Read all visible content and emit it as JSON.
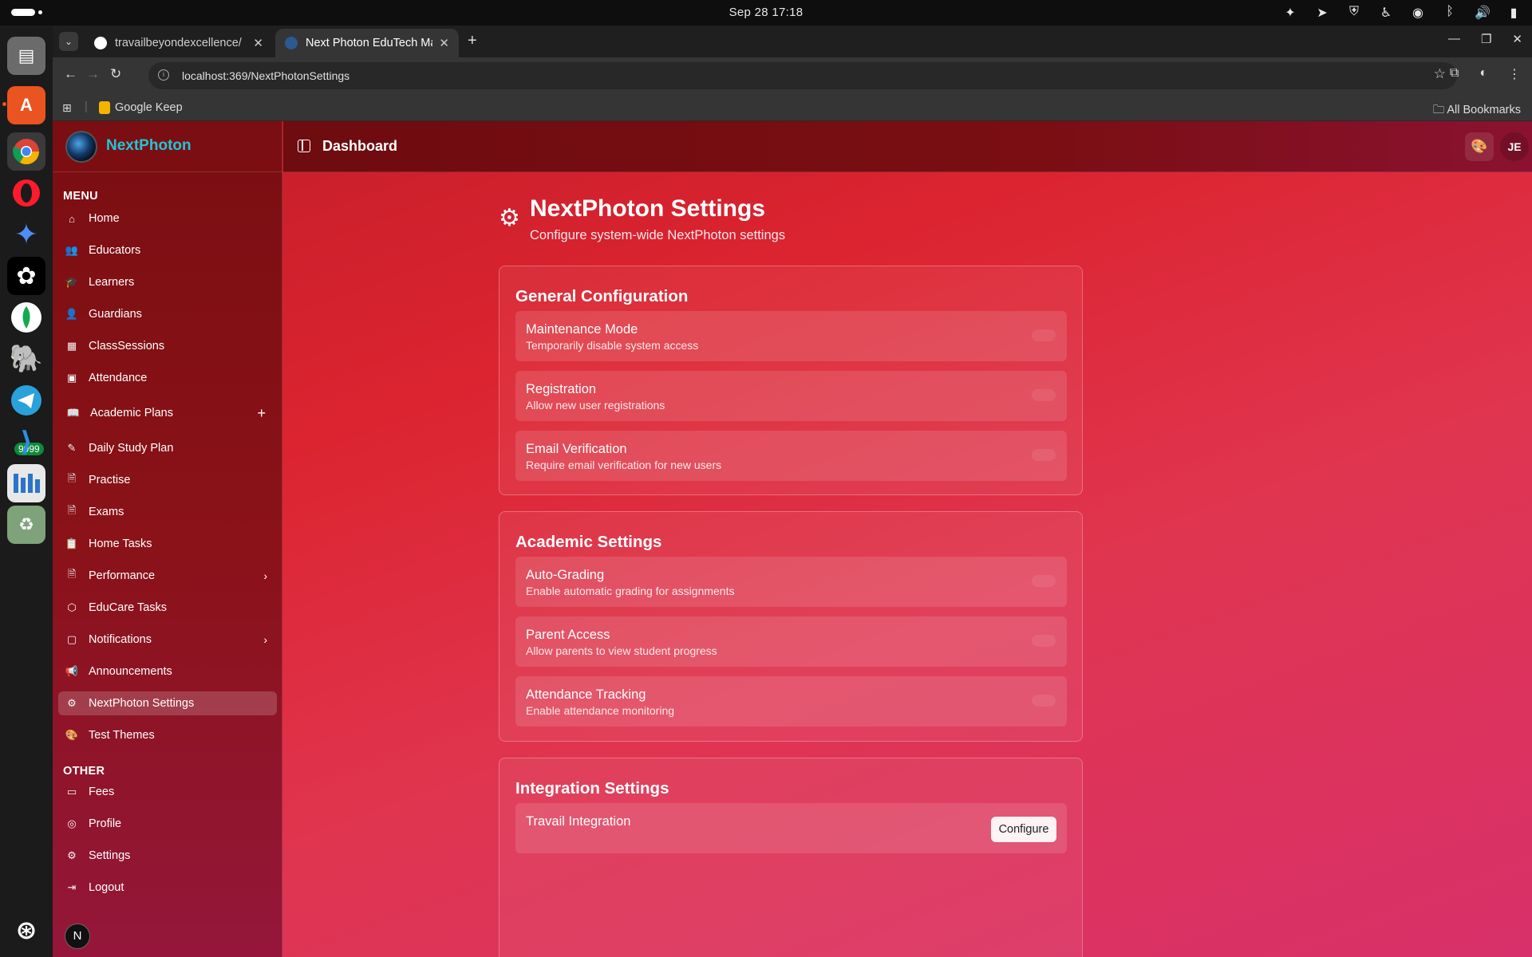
{
  "system": {
    "clock": "Sep 28  17:18"
  },
  "dock": {
    "badge": "9999"
  },
  "browser": {
    "tabs": [
      {
        "title": "travailbeyondexcellence/",
        "favicon_color": "#ffffff"
      },
      {
        "title": "Next Photon EduTech Ma",
        "favicon_color": "#2b5a8f"
      }
    ],
    "url": "localhost:369/NextPhotonSettings",
    "bookmarks": {
      "keep": "Google Keep",
      "all": "All Bookmarks"
    }
  },
  "app": {
    "brand": "NextPhoton",
    "header_title": "Dashboard",
    "user_initials": "JE",
    "sidebar": {
      "menu_heading": "MENU",
      "other_heading": "OTHER",
      "menu_items": [
        {
          "label": "Home",
          "icon": "home-icon"
        },
        {
          "label": "Educators",
          "icon": "users-icon"
        },
        {
          "label": "Learners",
          "icon": "graduation-cap-icon"
        },
        {
          "label": "Guardians",
          "icon": "user-icon"
        },
        {
          "label": "ClassSessions",
          "icon": "building-icon"
        },
        {
          "label": "Attendance",
          "icon": "calendar-icon"
        },
        {
          "label": "Academic Plans",
          "icon": "book-icon"
        },
        {
          "label": "Daily Study Plan",
          "icon": "edit-icon"
        },
        {
          "label": "Practise",
          "icon": "document-icon"
        },
        {
          "label": "Exams",
          "icon": "document-icon"
        },
        {
          "label": "Home Tasks",
          "icon": "clipboard-icon"
        },
        {
          "label": "Performance",
          "icon": "document-icon"
        },
        {
          "label": "EduCare Tasks",
          "icon": "package-icon"
        },
        {
          "label": "Notifications",
          "icon": "message-icon"
        },
        {
          "label": "Announcements",
          "icon": "megaphone-icon"
        },
        {
          "label": "NextPhoton Settings",
          "icon": "gear-icon"
        },
        {
          "label": "Test Themes",
          "icon": "palette-icon"
        }
      ],
      "other_items": [
        {
          "label": "Fees",
          "icon": "wallet-icon"
        },
        {
          "label": "Profile",
          "icon": "user-circle-icon"
        },
        {
          "label": "Settings",
          "icon": "gear-icon"
        },
        {
          "label": "Logout",
          "icon": "logout-icon"
        }
      ],
      "footer_avatar": "N"
    },
    "page": {
      "title": "NextPhoton Settings",
      "subtitle": "Configure system-wide NextPhoton settings",
      "sections": [
        {
          "title": "General Configuration",
          "settings": [
            {
              "label": "Maintenance Mode",
              "description": "Temporarily disable system access",
              "enabled": false
            },
            {
              "label": "Registration",
              "description": "Allow new user registrations",
              "enabled": false
            },
            {
              "label": "Email Verification",
              "description": "Require email verification for new users",
              "enabled": false
            }
          ]
        },
        {
          "title": "Academic Settings",
          "settings": [
            {
              "label": "Auto-Grading",
              "description": "Enable automatic grading for assignments",
              "enabled": false
            },
            {
              "label": "Parent Access",
              "description": "Allow parents to view student progress",
              "enabled": false
            },
            {
              "label": "Attendance Tracking",
              "description": "Enable attendance monitoring",
              "enabled": false
            }
          ]
        },
        {
          "title": "Integration Settings",
          "settings": [
            {
              "label": "Travail Integration",
              "button": "Configure"
            }
          ]
        }
      ]
    }
  }
}
